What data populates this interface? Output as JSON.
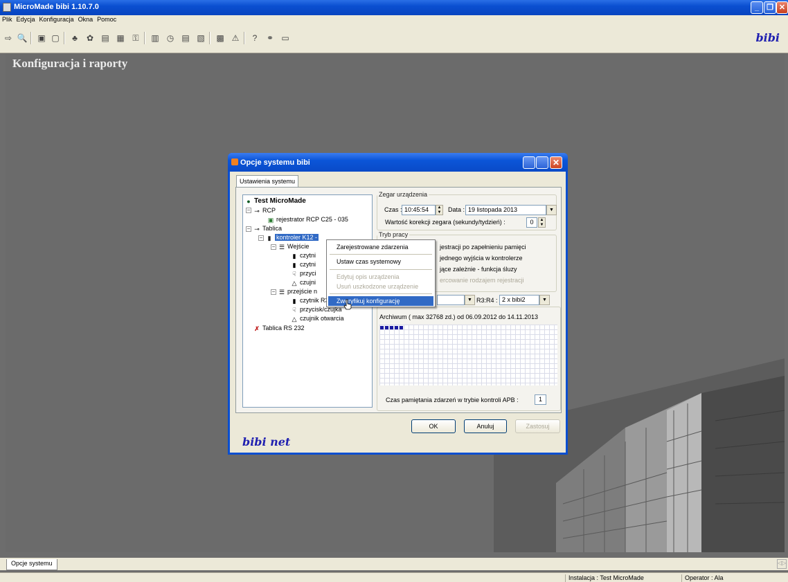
{
  "app": {
    "title": "MicroMade bibi 1.10.7.0",
    "brand": "bibi"
  },
  "menu": [
    "Plik",
    "Edycja",
    "Konfiguracja",
    "Okna",
    "Pomoc"
  ],
  "workspace": {
    "title": "Konfiguracja i raporty"
  },
  "dialog": {
    "title": "Opcje systemu bibi",
    "tab": "Ustawienia systemu",
    "tree": {
      "root": "Test MicroMade",
      "rcp": "RCP",
      "rcp_recorder": "rejestrator RCP C25 - 035",
      "tablica": "Tablica",
      "controller": "kontroler K12 - ",
      "wejscie": "Wejście",
      "czytnik1": "czytni",
      "czytnik2": "czytni",
      "przycisk1": "przyci",
      "czujnik1": "czujni",
      "przejscie": "przejście n",
      "czytnik3": "czytnik R32 - 6275",
      "przycisk2": "przycisk/czujka",
      "czujnik2": "czujnik otwarcia",
      "tablica_rs": "Tablica RS 232"
    },
    "clock": {
      "legend": "Zegar urządzenia",
      "time_label": "Czas :",
      "time_value": "10:45:54",
      "date_label": "Data :",
      "date_value": "19   listopada   2013",
      "correction_label": "Wartość korekcji zegara (sekundy/tydzień) :",
      "correction_value": "0"
    },
    "mode": {
      "legend": "Tryb pracy",
      "opt1": "jestracji po zapełnieniu pamięci",
      "opt2": "jednego wyjścia w kontrolerze",
      "opt3": "jące zależnie - funkcja śluzy",
      "opt4": "ercowanie rodzajem rejestracji"
    },
    "r3r4_label": "R3:R4 :",
    "r3r4_value": "2 x bibi2",
    "archive": "Archiwum ( max 32768 zd.) od 06.09.2012 do 14.11.2013",
    "apb_label": "Czas pamiętania zdarzeń w trybie kontroli APB :",
    "apb_value": "1",
    "ok": "OK",
    "cancel": "Anuluj",
    "apply": "Zastosuj",
    "logo": "bibi net"
  },
  "context_menu": {
    "items": [
      "Zarejestrowane zdarzenia",
      "Ustaw czas systemowy",
      "Edytuj opis urządzenia",
      "Usuń uszkodzone urządzenie",
      "Zweryfikuj konfigurację"
    ]
  },
  "bottom_tab": "Opcje systemu",
  "status": {
    "installation": "Instalacja : Test MicroMade",
    "operator": "Operator : Ala"
  },
  "colors": {
    "titlebar": "#0a4fd0",
    "selection": "#316ac5",
    "workspace": "#6b6b6b",
    "brand": "#2020b0"
  }
}
